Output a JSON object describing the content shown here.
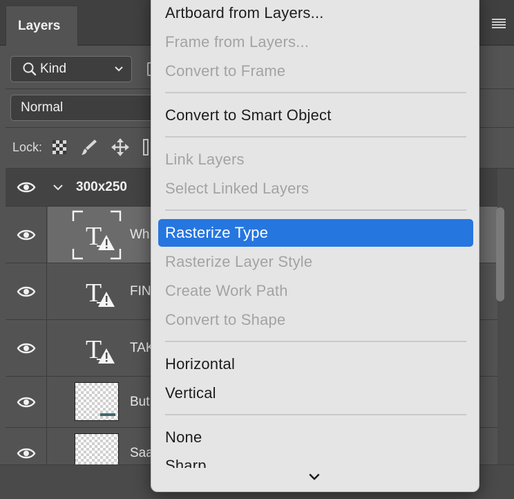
{
  "panel": {
    "tab_title": "Layers",
    "filter": {
      "selected": "Kind"
    },
    "blend_mode": {
      "selected": "Normal"
    },
    "lock_label": "Lock:"
  },
  "layers": {
    "group": {
      "name": "300x250"
    },
    "rows": [
      {
        "name": "Wh",
        "type": "text-warning",
        "selected": true
      },
      {
        "name": "FIN",
        "type": "text-warning",
        "selected": false
      },
      {
        "name": "TAK",
        "type": "text-warning",
        "selected": false
      },
      {
        "name": "But",
        "type": "image",
        "selected": false
      },
      {
        "name": "Saa",
        "type": "image",
        "selected": false
      }
    ]
  },
  "menu": {
    "items": [
      {
        "label": "Artboard from Layers...",
        "enabled": true
      },
      {
        "label": "Frame from Layers...",
        "enabled": false
      },
      {
        "label": "Convert to Frame",
        "enabled": false
      },
      {
        "label": "Convert to Smart Object",
        "enabled": true
      },
      {
        "label": "Link Layers",
        "enabled": false
      },
      {
        "label": "Select Linked Layers",
        "enabled": false
      },
      {
        "label": "Rasterize Type",
        "enabled": true,
        "highlighted": true
      },
      {
        "label": "Rasterize Layer Style",
        "enabled": false
      },
      {
        "label": "Create Work Path",
        "enabled": false
      },
      {
        "label": "Convert to Shape",
        "enabled": false
      },
      {
        "label": "Horizontal",
        "enabled": true
      },
      {
        "label": "Vertical",
        "enabled": true
      },
      {
        "label": "None",
        "enabled": true
      },
      {
        "label": "Sharp",
        "enabled": true
      }
    ]
  },
  "colors": {
    "panel_bg": "#535353",
    "menu_bg": "#e5e5e5",
    "menu_highlight": "#2676e0",
    "menu_disabled_text": "#a3a3a3",
    "selected_layer_bg": "#6b6b6b",
    "thumb_accent": "#3e6b6e"
  }
}
